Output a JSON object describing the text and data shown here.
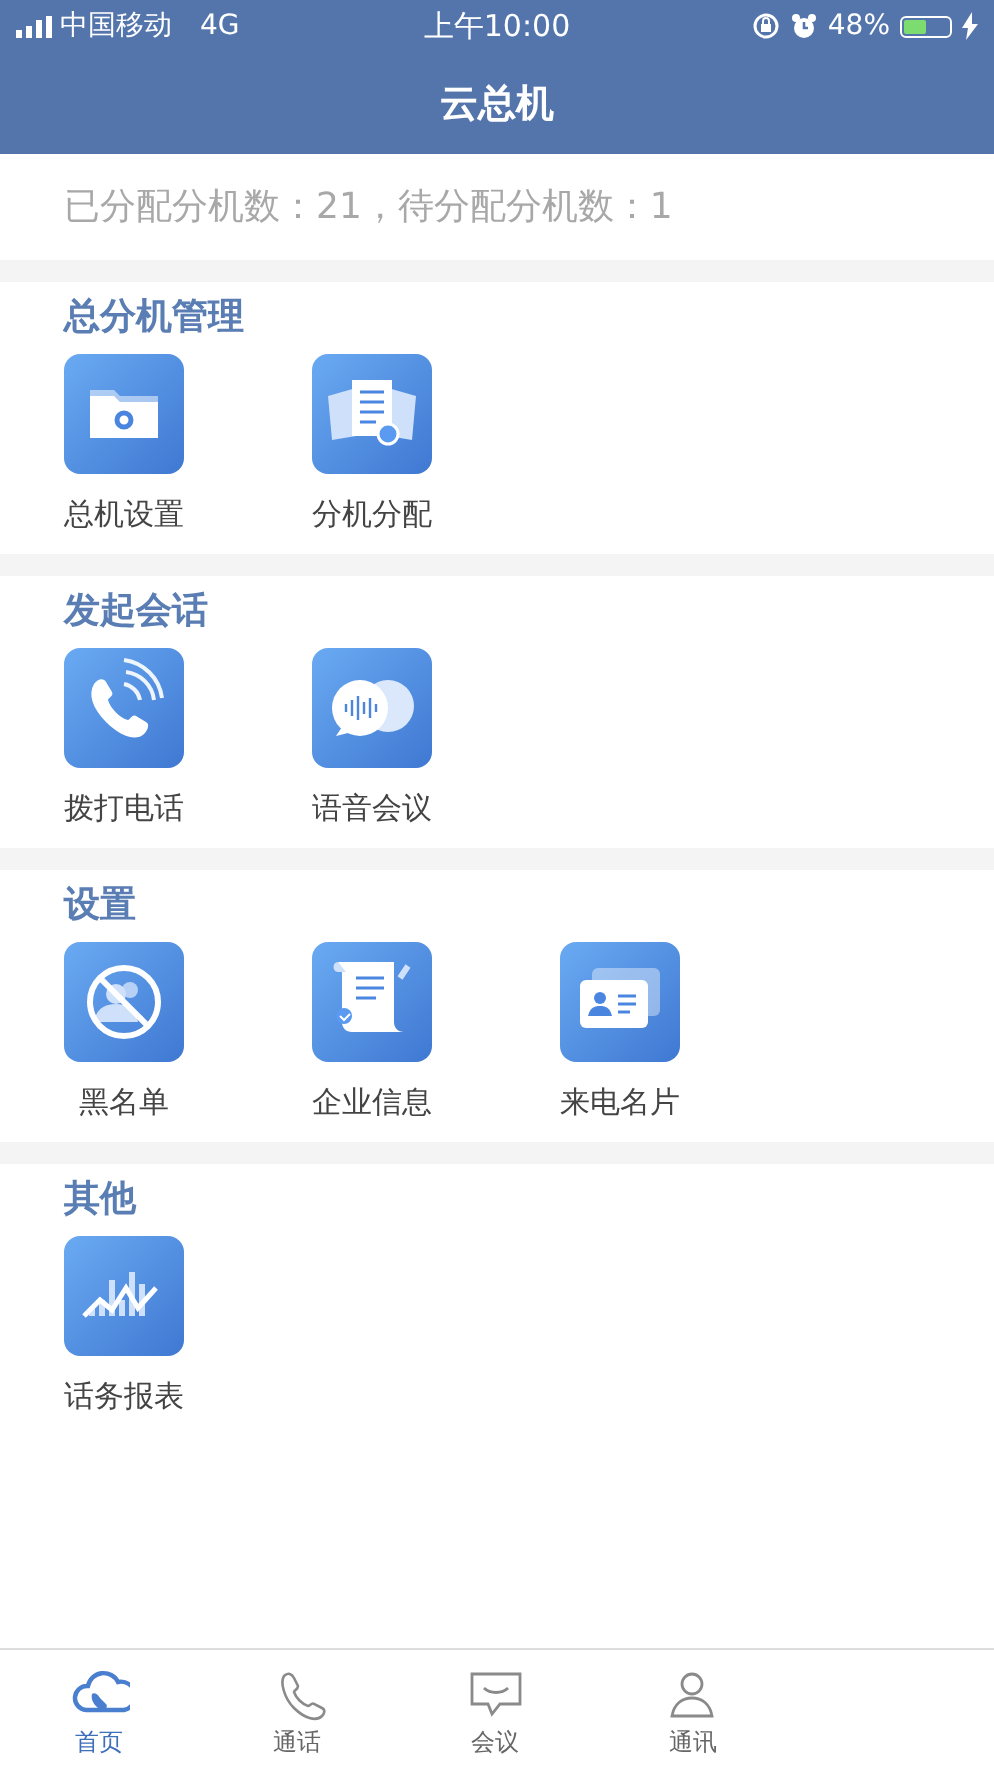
{
  "status_bar": {
    "carrier": "中国移动",
    "network": "4G",
    "time": "上午10:00",
    "battery_percent": "48%",
    "battery": {
      "level": 0.48
    },
    "charging": true
  },
  "nav_bar": {
    "title": "云总机"
  },
  "summary": "已分配分机数：21，待分配分机数：1",
  "sections": [
    {
      "title": "总分机管理",
      "items": [
        {
          "label": "总机设置",
          "kind": "folder-gear"
        },
        {
          "label": "分机分配",
          "kind": "documents"
        }
      ]
    },
    {
      "title": "发起会话",
      "items": [
        {
          "label": "拨打电话",
          "kind": "phone"
        },
        {
          "label": "语音会议",
          "kind": "voice-chat"
        }
      ]
    },
    {
      "title": "设置",
      "items": [
        {
          "label": "黑名单",
          "kind": "blocked"
        },
        {
          "label": "企业信息",
          "kind": "scroll"
        },
        {
          "label": "来电名片",
          "kind": "card"
        }
      ]
    },
    {
      "title": "其他",
      "items": [
        {
          "label": "话务报表",
          "kind": "chart"
        }
      ]
    }
  ],
  "tab_bar": [
    {
      "label": "首页",
      "kind": "cloud",
      "selected": true
    },
    {
      "label": "通话",
      "kind": "phone",
      "selected": false
    },
    {
      "label": "会议",
      "kind": "chat",
      "selected": false
    },
    {
      "label": "通讯",
      "kind": "person",
      "selected": false
    }
  ]
}
